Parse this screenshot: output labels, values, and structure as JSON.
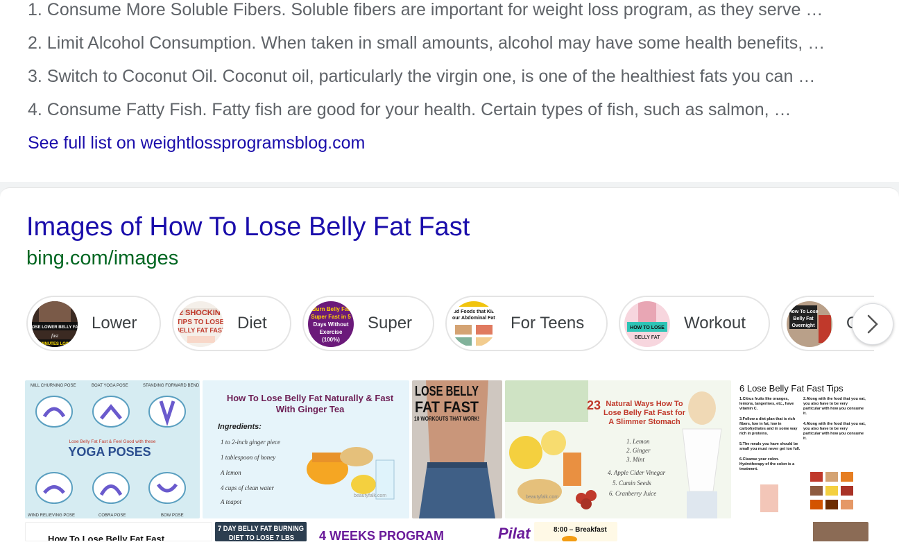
{
  "list": {
    "items": [
      "1. Consume More Soluble Fibers. Soluble fibers are important for weight loss program, as they serve …",
      "2. Limit Alcohol Consumption. When taken in small amounts, alcohol may have some health benefits, …",
      "3. Switch to Coconut Oil. Coconut oil, particularly the virgin one, is one of the healthiest fats you can …",
      "4. Consume Fatty Fish. Fatty fish are good for your health. Certain types of fish, such as salmon, …"
    ],
    "see_full": "See full list on weightlossprogramsblog.com"
  },
  "images": {
    "title": "Images of How To Lose Belly Fat Fast",
    "url": "bing.com/images",
    "chips": [
      {
        "label": "Lower",
        "thumb_text": "LOSE LOWER BELLY FAT"
      },
      {
        "label": "Diet",
        "thumb_text": "12 SHOCKING TIPS TO LOSE BELLY FAT FAST"
      },
      {
        "label": "Super",
        "thumb_text": "Burn Belly Fat Super Fast in 5 Days Without Exercise (100%)"
      },
      {
        "label": "For Teens",
        "thumb_text": "Add Foods that KILL your Abdominal Fat?"
      },
      {
        "label": "Workout",
        "thumb_text": "HOW TO LOSE BELLY FAT"
      },
      {
        "label": "O",
        "thumb_text": "How To Lose Belly Fat Overnight"
      }
    ],
    "tiles": [
      {
        "top": "YOGA POSES",
        "sub": "Lose Belly Fat Fast & Feel Good with these",
        "poses": [
          "MILL CHURNING POSE",
          "BOAT YOGA POSE",
          "STANDING FORWARD BEND",
          "WIND RELIEVING POSE",
          "COBRA POSE",
          "BOW POSE"
        ]
      },
      {
        "title": "How To Lose Belly Fat Naturally & Fast With Ginger Tea",
        "heading": "Ingredients:",
        "items": [
          "1 to 2-inch ginger piece",
          "1 tablespoon of honey",
          "A lemon",
          "4 cups of clean water",
          "A teapot"
        ],
        "credit": "beautyfalk.com"
      },
      {
        "title": "LOSE BELLY FAT FAST",
        "sub": "10 WORKOUTS THAT WORK!"
      },
      {
        "num": "23",
        "title": "Natural Ways How To Lose Belly Fat Fast for A Slimmer Stomach",
        "items": [
          "1. Lemon",
          "2. Ginger",
          "3. Mint",
          "4. Apple Cider Vinegar",
          "5. Cumin Seeds",
          "6. Cranberry Juice"
        ],
        "credit": "beautyfalk.com"
      },
      {
        "title": "6 Lose Belly Fat Fast Tips",
        "tips": [
          "1.Citrus fruits like oranges, lemons, tangerines, etc., have vitamin C.",
          "2.Along with the food that you eat, you also have to be very particular with how you consume it.",
          "3.Follow a diet plan that is rich fibers, low in fat, low in carbohydrates and in some way rich in proteins.",
          "4.Along with the food that you eat, you also have to be very particular with how you consume it.",
          "5.The meals you have should be small you must never get too full.",
          "6.Cleanse your colon. Hydrotherapy of the colon is a treatment."
        ]
      }
    ],
    "bottom_tiles": [
      "How To Lose Belly Fat Fast",
      "7 DAY BELLY FAT BURNING DIET TO LOSE 7 LBS",
      "4 WEEKS PROGRAM",
      "Pilat",
      "8:00 – Breakfast"
    ]
  },
  "colors": {
    "link": "#1a0dab",
    "url": "#006621",
    "text": "#5f6368"
  }
}
